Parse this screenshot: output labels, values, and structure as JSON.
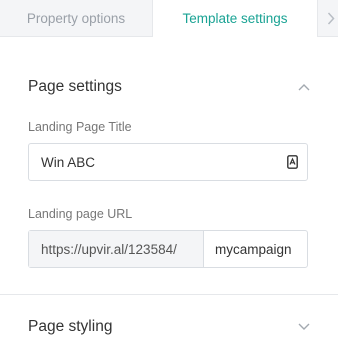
{
  "tabs": {
    "property_options": "Property options",
    "template_settings": "Template settings",
    "next_icon": "chevron-right-icon"
  },
  "page_settings": {
    "title": "Page settings",
    "collapse_icon": "chevron-up-icon",
    "landing_title_label": "Landing Page Title",
    "landing_title_value": "Win ABC",
    "landing_title_icon": "text-field-icon",
    "landing_url_label": "Landing page URL",
    "landing_url_prefix": "https://upvir.al/123584/",
    "landing_url_slug": "mycampaign"
  },
  "page_styling": {
    "title": "Page styling",
    "expand_icon": "chevron-down-icon"
  },
  "colors": {
    "accent": "#1aa394",
    "tab_bg": "#f4f5f7",
    "border": "#d9dde2"
  }
}
